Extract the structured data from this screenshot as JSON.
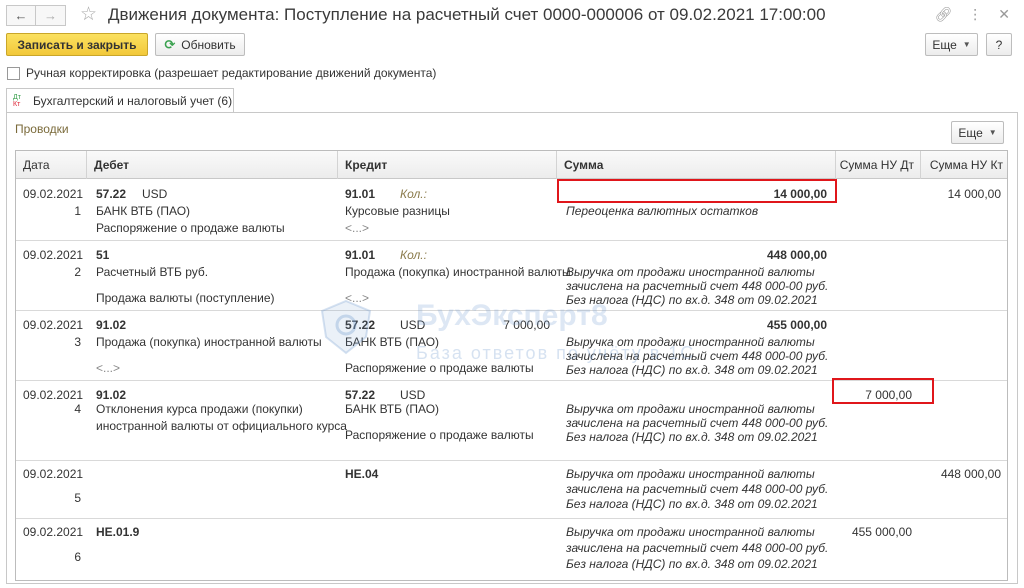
{
  "window": {
    "title": "Движения документа: Поступление на расчетный счет 0000-000006 от 09.02.2021 17:00:00",
    "back_icon": "arrow-left-icon",
    "forward_icon": "arrow-right-icon",
    "favorite_icon": "star-icon",
    "link_icon": "link-icon",
    "menu_icon": "more-icon",
    "close_icon": "close-icon"
  },
  "toolbar": {
    "save_close_label": "Записать и закрыть",
    "refresh_label": "Обновить",
    "more_label": "Еще",
    "help_label": "?"
  },
  "manual_correction": {
    "label": "Ручная корректировка (разрешает редактирование движений документа)",
    "checked": false
  },
  "tab": {
    "label": "Бухгалтерский и налоговый учет (6)",
    "icon_dt": "Дт",
    "icon_kt": "Кт"
  },
  "entries": {
    "section_label": "Проводки",
    "more_label": "Еще",
    "columns": [
      "Дата",
      "Дебет",
      "Кредит",
      "Сумма",
      "Сумма НУ Дт",
      "Сумма НУ Кт"
    ],
    "rows": [
      {
        "date": "09.02.2021",
        "num": "1",
        "debit_account": "57.22",
        "debit_currency": "USD",
        "debit_sub1": "БАНК ВТБ (ПАО)",
        "debit_sub2": "Распоряжение о продаже валюты",
        "credit_account": "91.01",
        "credit_qty_label": "Кол.:",
        "credit_sub1": "Курсовые разницы",
        "credit_sub2": "<...>",
        "amount": "14 000,00",
        "amount_text": "Переоценка валютных остатков",
        "nu_dt": "",
        "nu_kt": "14 000,00"
      },
      {
        "date": "09.02.2021",
        "num": "2",
        "debit_account": "51",
        "debit_sub1": "Расчетный ВТБ руб.",
        "debit_sub2": "Продажа валюты (поступление)",
        "credit_account": "91.01",
        "credit_qty_label": "Кол.:",
        "credit_sub1": "Продажа (покупка) иностранной валюты",
        "credit_sub2": "<...>",
        "amount": "448 000,00",
        "amount_text1": "Выручка от продажи иностранной валюты",
        "amount_text2": "зачислена на расчетный счет 448 000-00 руб.",
        "amount_text3": "Без налога (НДС) по вх.д. 348 от 09.02.2021"
      },
      {
        "date": "09.02.2021",
        "num": "3",
        "debit_account": "91.02",
        "debit_sub1": "Продажа (покупка) иностранной валюты",
        "debit_sub2": "<...>",
        "credit_account": "57.22",
        "credit_currency": "USD",
        "credit_currency_amount": "7 000,00",
        "credit_sub1": "БАНК ВТБ (ПАО)",
        "credit_sub2": "Распоряжение о продаже валюты",
        "amount": "455 000,00",
        "amount_text1": "Выручка от продажи иностранной валюты",
        "amount_text2": "зачислена на расчетный счет 448 000-00 руб.",
        "amount_text3": "Без налога (НДС) по вх.д. 348 от 09.02.2021"
      },
      {
        "date": "09.02.2021",
        "num": "4",
        "debit_account": "91.02",
        "debit_sub1": "Отклонения курса продажи (покупки)",
        "debit_sub2": "иностранной валюты от официального курса",
        "credit_account": "57.22",
        "credit_currency": "USD",
        "credit_sub1": "БАНК ВТБ (ПАО)",
        "credit_sub2": "Распоряжение о продаже валюты",
        "amount": "",
        "amount_text1": "Выручка от продажи иностранной валюты",
        "amount_text2": "зачислена на расчетный счет 448 000-00 руб.",
        "amount_text3": "Без налога (НДС) по вх.д. 348 от 09.02.2021",
        "nu_dt": "7 000,00"
      },
      {
        "date": "09.02.2021",
        "num": "5",
        "credit_account": "НЕ.04",
        "amount_text1": "Выручка от продажи иностранной валюты",
        "amount_text2": "зачислена на расчетный счет 448 000-00 руб.",
        "amount_text3": "Без налога (НДС) по вх.д. 348 от 09.02.2021",
        "nu_kt": "448 000,00"
      },
      {
        "date": "09.02.2021",
        "num": "6",
        "debit_account": "НЕ.01.9",
        "amount_text1": "Выручка от продажи иностранной валюты",
        "amount_text2": "зачислена на расчетный счет 448 000-00 руб.",
        "amount_text3": "Без налога (НДС) по вх.д. 348 от 09.02.2021",
        "nu_dt": "455 000,00"
      }
    ]
  },
  "watermark": {
    "text": "БухЭксперт8",
    "subtext": "База ответов по учёту в 1С"
  }
}
